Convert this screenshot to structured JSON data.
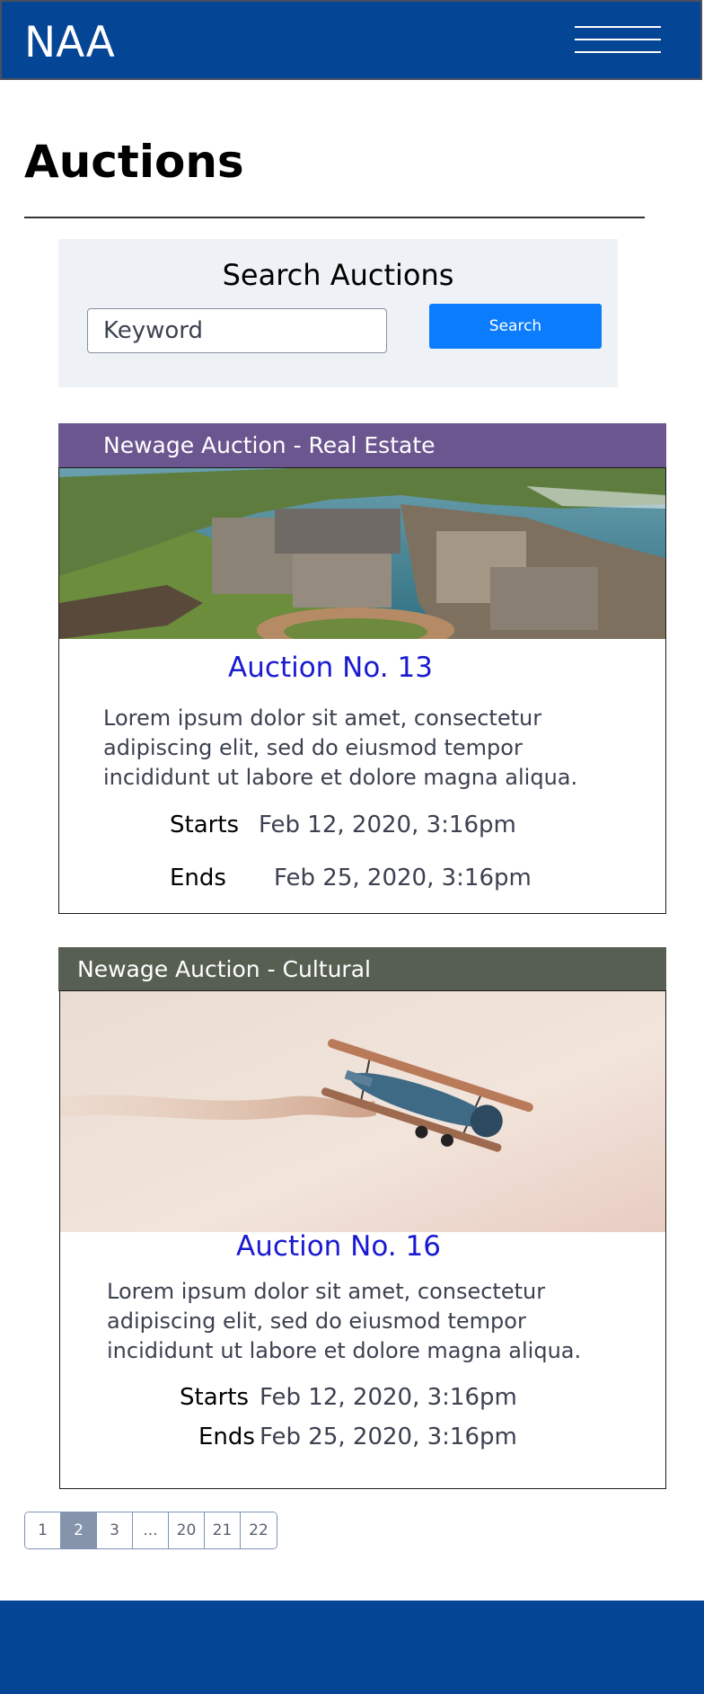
{
  "header": {
    "logo": "NAA",
    "menu_icon": "hamburger-menu-icon"
  },
  "page": {
    "title": "Auctions"
  },
  "search": {
    "title": "Search Auctions",
    "placeholder": "Keyword",
    "value": "",
    "button_label": "Search"
  },
  "auctions": [
    {
      "category": "Newage Auction - Real Estate",
      "header_color": "#6b5690",
      "image": "coastal-castle-aerial-photo",
      "title": "Auction No. 13",
      "description": "Lorem ipsum dolor sit amet, consectetur adipiscing elit, sed do eiusmod tempor incididunt ut labore et dolore magna aliqua.",
      "starts_label": "Starts",
      "starts": "Feb 12, 2020, 3:16pm",
      "ends_label": "Ends",
      "ends": "Feb 25, 2020, 3:16pm"
    },
    {
      "category": "Newage Auction - Cultural",
      "header_color": "#575f53",
      "image": "biplane-with-smoke-trail-photo",
      "title": "Auction No. 16",
      "description": "Lorem ipsum dolor sit amet, consectetur adipiscing elit, sed do eiusmod tempor incididunt ut labore et dolore magna aliqua.",
      "starts_label": "Starts",
      "starts": "Feb 12, 2020, 3:16pm",
      "ends_label": "Ends",
      "ends": "Feb 25, 2020, 3:16pm"
    }
  ],
  "pagination": {
    "pages": [
      "1",
      "2",
      "3",
      "...",
      "20",
      "21",
      "22"
    ],
    "active": "2"
  },
  "colors": {
    "brand": "#054595",
    "accent_button": "#0a7cfd",
    "link_title": "#1a1ad1",
    "search_panel": "#eef1f6"
  }
}
